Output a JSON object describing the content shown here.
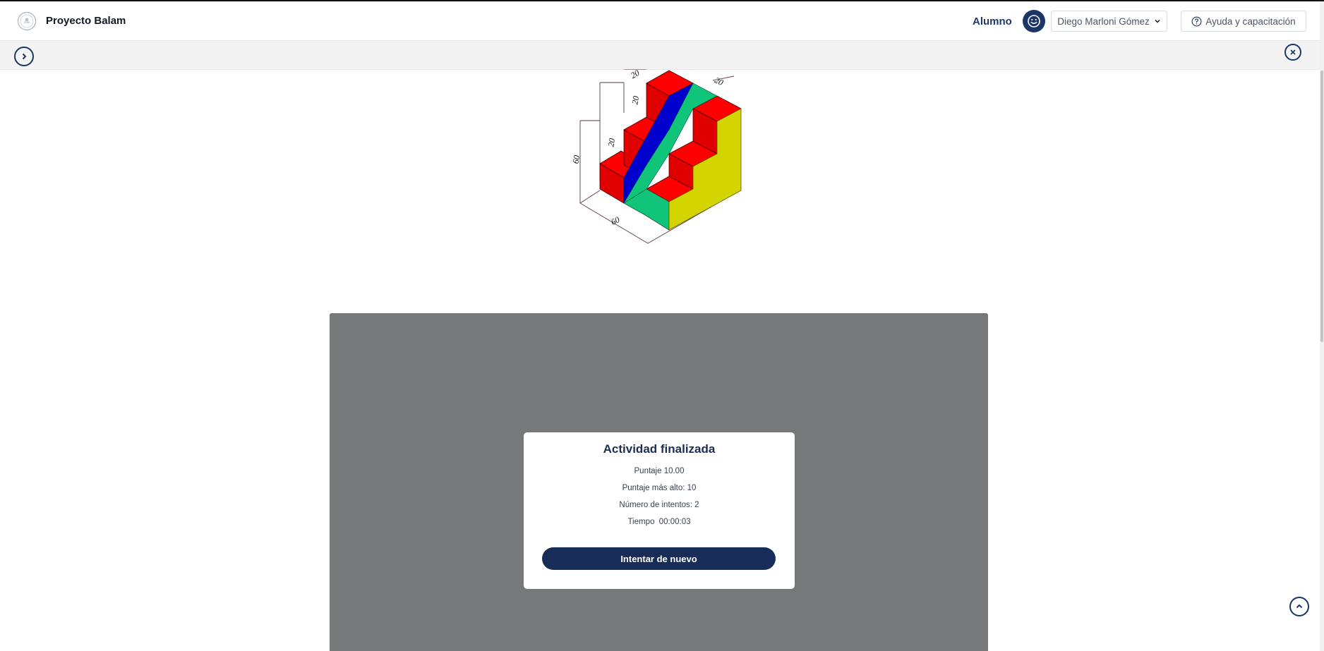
{
  "header": {
    "brand": "Proyecto Balam",
    "role": "Alumno",
    "user_name": "Diego Marloni Gómez",
    "help_label": "Ayuda y capacitación"
  },
  "figure": {
    "dimension_labels": [
      "20",
      "20",
      "20",
      "20",
      "60",
      "60"
    ]
  },
  "result": {
    "title": "Actividad finalizada",
    "score": "Puntaje 10.00",
    "high_score": "Puntaje más alto: 10",
    "attempts": "Número de intentos: 2",
    "time": "Tiempo  00:00:03",
    "retry_label": "Intentar de nuevo"
  },
  "colors": {
    "primary": "#172d57",
    "overlay": "#77787a",
    "cube_red": "#ff0000",
    "cube_blue": "#0000cc",
    "cube_green": "#10c47a",
    "cube_yellow": "#d4d400"
  },
  "icons": {
    "logo": "university-seal-icon",
    "avatar": "smiley-icon",
    "user_menu": "chevron-down-icon",
    "help": "question-circle-icon",
    "expand": "chevron-right-circle-icon",
    "close": "close-circle-icon",
    "scroll_top": "chevron-up-circle-icon"
  }
}
